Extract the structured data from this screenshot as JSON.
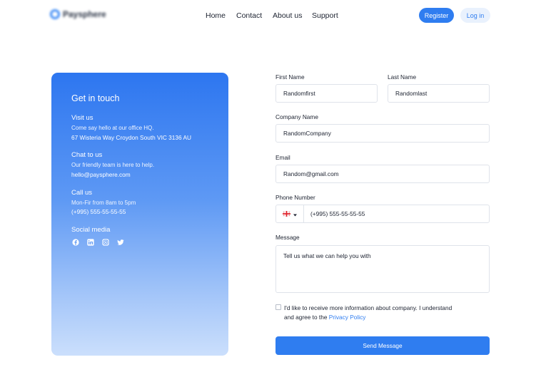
{
  "brand": {
    "name": "Paysphere"
  },
  "nav": [
    {
      "label": "Home"
    },
    {
      "label": "Contact"
    },
    {
      "label": "About us"
    },
    {
      "label": "Support"
    }
  ],
  "auth": {
    "register_label": "Register",
    "login_label": "Log in"
  },
  "info": {
    "title": "Get in touch",
    "visit": {
      "title": "Visit us",
      "line": "Come say hello at our office HQ.",
      "detail": "67 Wisteria Way Croydon South VIC 3136 AU"
    },
    "chat": {
      "title": "Chat to us",
      "line": "Our friendly team is here to help.",
      "detail": "hello@paysphere.com"
    },
    "call": {
      "title": "Call us",
      "line": "Mon-Fir from 8am to 5pm",
      "detail": "(+995) 555-55-55-55"
    },
    "social": {
      "title": "Social media",
      "icons": [
        "facebook-icon",
        "linkedin-icon",
        "instagram-icon",
        "twitter-icon"
      ]
    }
  },
  "form": {
    "first_name": {
      "label": "First Name",
      "value": "Randomfirst"
    },
    "last_name": {
      "label": "Last Name",
      "value": "Randomlast"
    },
    "company": {
      "label": "Company Name",
      "value": "RandomCompany"
    },
    "email": {
      "label": "Email",
      "value": "Random@gmail.com"
    },
    "phone": {
      "label": "Phone Number",
      "value": "(+995) 555-55-55-55",
      "country_flag": "georgia-flag-icon"
    },
    "message": {
      "label": "Message",
      "placeholder": "Tell us what we can help you with"
    },
    "consent": {
      "text": "I'd like to receive more information about company. I understand and agree to the",
      "link": "Privacy Policy",
      "checked": false
    },
    "submit_label": "Send Message"
  },
  "colors": {
    "accent": "#2f7df0",
    "card_top": "#2d76f0",
    "card_bottom": "#cbdffc",
    "border": "#dfe3ea"
  }
}
